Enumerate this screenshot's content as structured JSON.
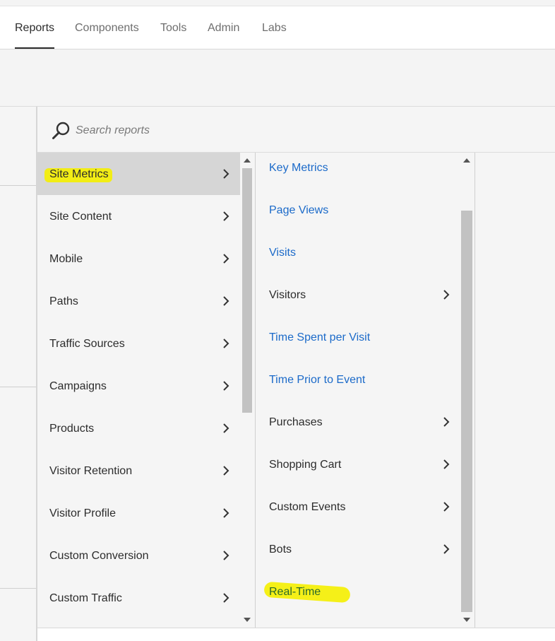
{
  "nav": {
    "tabs": [
      "Reports",
      "Components",
      "Tools",
      "Admin",
      "Labs"
    ],
    "active": "Reports"
  },
  "search": {
    "placeholder": "Search reports",
    "value": ""
  },
  "column1": {
    "items": [
      "Site Metrics",
      "Site Content",
      "Mobile",
      "Paths",
      "Traffic Sources",
      "Campaigns",
      "Products",
      "Visitor Retention",
      "Visitor Profile",
      "Custom Conversion",
      "Custom Traffic"
    ],
    "selected": "Site Metrics"
  },
  "column2": {
    "items": [
      {
        "label": "Key Metrics",
        "link": true,
        "submenu": false
      },
      {
        "label": "Page Views",
        "link": true,
        "submenu": false
      },
      {
        "label": "Visits",
        "link": true,
        "submenu": false
      },
      {
        "label": "Visitors",
        "link": false,
        "submenu": true
      },
      {
        "label": "Time Spent per Visit",
        "link": true,
        "submenu": false
      },
      {
        "label": "Time Prior to Event",
        "link": true,
        "submenu": false
      },
      {
        "label": "Purchases",
        "link": false,
        "submenu": true
      },
      {
        "label": "Shopping Cart",
        "link": false,
        "submenu": true
      },
      {
        "label": "Custom Events",
        "link": false,
        "submenu": true
      },
      {
        "label": "Bots",
        "link": false,
        "submenu": true
      },
      {
        "label": "Real-Time",
        "link": true,
        "submenu": false
      }
    ]
  },
  "colors": {
    "link": "#1b6ac9",
    "highlight": "#f5f000",
    "selected_bg": "#d6d6d6"
  },
  "icons": {
    "search": "search-icon",
    "chevron": "chevron-right-icon"
  }
}
